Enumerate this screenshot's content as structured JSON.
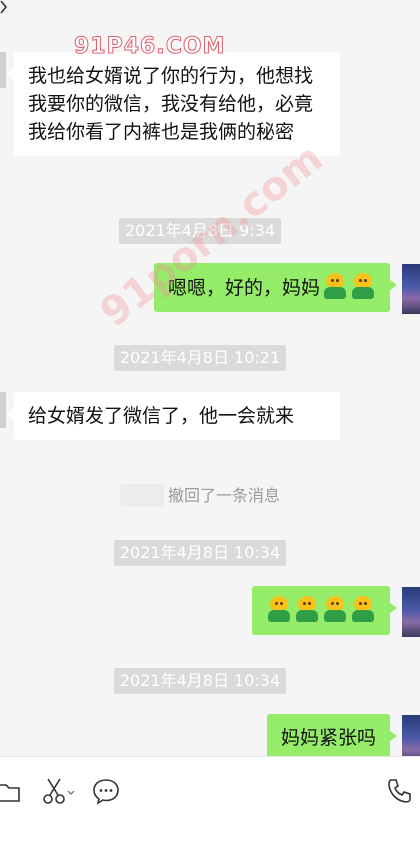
{
  "watermarks": {
    "top": "91P46.COM",
    "diagonal": "91porn.com"
  },
  "messages": [
    {
      "type": "incoming",
      "text": "我也给女婿说了你的行为，他想找我要你的微信，我没有给他，必竟我给你看了内裤也是我俩的秘密"
    },
    {
      "type": "timestamp",
      "text": "2021年4月8日 9:34"
    },
    {
      "type": "outgoing",
      "text": "嗯嗯，好的，妈妈",
      "emojis": [
        "shrug-emoji",
        "shrug-emoji"
      ]
    },
    {
      "type": "timestamp",
      "text": "2021年4月8日 10:21"
    },
    {
      "type": "incoming",
      "text": "给女婿发了微信了，他一会就来"
    },
    {
      "type": "system",
      "text": "撤回了一条消息"
    },
    {
      "type": "timestamp",
      "text": "2021年4月8日 10:34"
    },
    {
      "type": "outgoing",
      "text": "",
      "emojis": [
        "shrug-emoji",
        "shrug-emoji",
        "shrug-emoji",
        "shrug-emoji"
      ]
    },
    {
      "type": "timestamp",
      "text": "2021年4月8日 10:34"
    },
    {
      "type": "outgoing",
      "text": "妈妈紧张吗"
    }
  ],
  "toolbar": {
    "icons": [
      "folder-icon",
      "scissors-icon",
      "chat-bubble-icon",
      "phone-icon"
    ]
  },
  "colors": {
    "outgoing_bubble": "#95ec69",
    "incoming_bubble": "#ffffff",
    "background": "#f5f5f5",
    "timestamp_bg": "#dadada"
  }
}
